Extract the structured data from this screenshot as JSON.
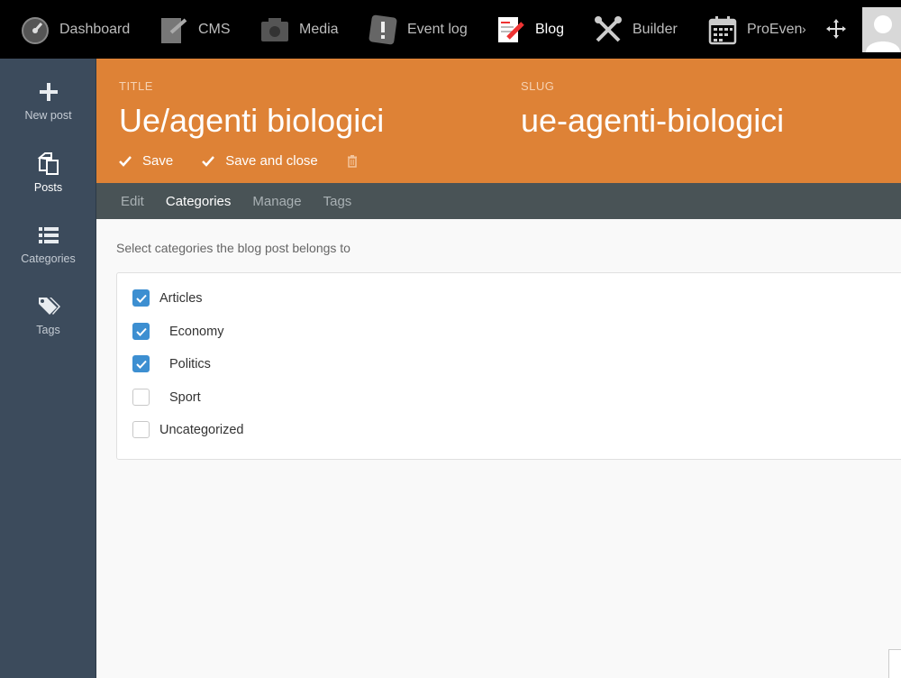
{
  "nav": {
    "items": [
      {
        "label": "Dashboard",
        "icon": "dashboard-gauge-icon"
      },
      {
        "label": "CMS",
        "icon": "cms-page-icon"
      },
      {
        "label": "Media",
        "icon": "media-camera-icon"
      },
      {
        "label": "Event log",
        "icon": "event-log-exclamation-icon"
      },
      {
        "label": "Blog",
        "icon": "blog-pencil-icon"
      },
      {
        "label": "Builder",
        "icon": "builder-tools-icon"
      },
      {
        "label": "ProEven",
        "icon": "calendar-icon"
      }
    ],
    "overflow": "›"
  },
  "sidebar": {
    "items": [
      {
        "label": "New post",
        "icon": "plus-icon"
      },
      {
        "label": "Posts",
        "icon": "copy-icon"
      },
      {
        "label": "Categories",
        "icon": "list-icon"
      },
      {
        "label": "Tags",
        "icon": "tags-icon"
      }
    ]
  },
  "header": {
    "title_label": "TITLE",
    "title_value": "Ue/agenti biologici",
    "slug_label": "SLUG",
    "slug_value": "ue-agenti-biologici",
    "save_label": "Save",
    "save_close_label": "Save and close"
  },
  "tabs": [
    {
      "label": "Edit"
    },
    {
      "label": "Categories"
    },
    {
      "label": "Manage"
    },
    {
      "label": "Tags"
    }
  ],
  "content": {
    "hint": "Select categories the blog post belongs to",
    "categories": [
      {
        "label": "Articles",
        "checked": true
      },
      {
        "label": "Economy",
        "checked": true
      },
      {
        "label": "Politics",
        "checked": true
      },
      {
        "label": "Sport",
        "checked": false
      },
      {
        "label": "Uncategorized",
        "checked": false
      }
    ]
  },
  "colors": {
    "accent": "#de8236",
    "sidebar": "#3c4b5c",
    "tabs": "#495356",
    "checkbox": "#3d8fd1"
  }
}
